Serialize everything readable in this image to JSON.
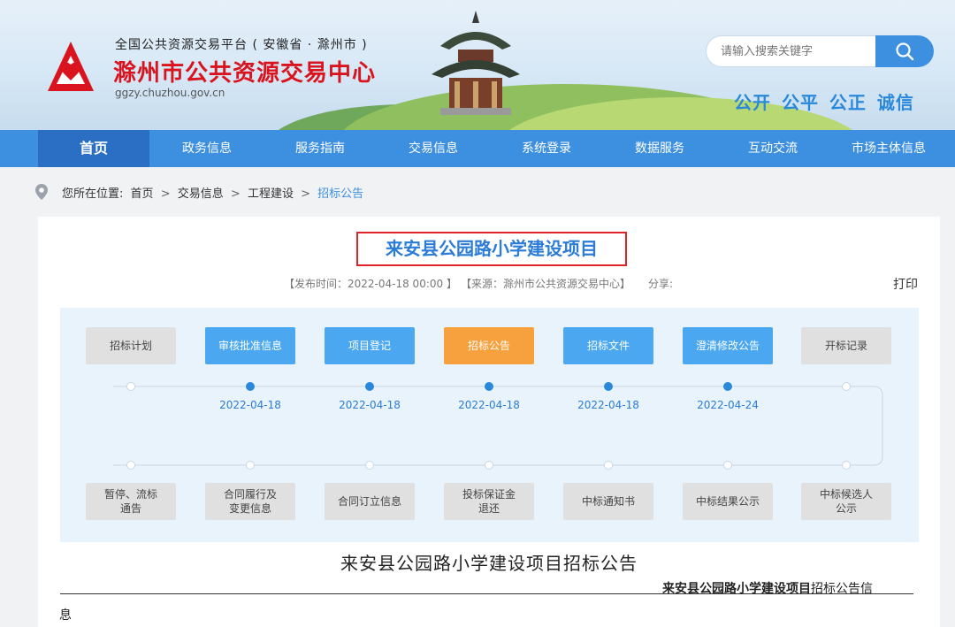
{
  "header": {
    "subtitle": "全国公共资源交易平台 ( 安徽省 · 滁州市 )",
    "title": "滁州市公共资源交易中心",
    "domain": "ggzy.chuzhou.gov.cn",
    "search_placeholder": "请输入搜索关键字",
    "slogan": "公开 公平 公正 诚信"
  },
  "nav": {
    "items": [
      "首页",
      "政务信息",
      "服务指南",
      "交易信息",
      "系统登录",
      "数据服务",
      "互动交流",
      "市场主体信息"
    ],
    "active_index": 0
  },
  "breadcrumb": {
    "label": "您所在位置:",
    "items": [
      "首页",
      "交易信息",
      "工程建设",
      "招标公告"
    ],
    "separator": ">"
  },
  "project": {
    "title": "来安县公园路小学建设项目",
    "publish": "【发布时间：2022-04-18 00:00 】",
    "source": "【来源：滁州市公共资源交易中心】",
    "share": "分享:",
    "print": "打印"
  },
  "flow": {
    "top_steps": [
      {
        "label": "招标计划",
        "state": "gray",
        "date": ""
      },
      {
        "label": "审核批准信息",
        "state": "blue",
        "date": "2022-04-18"
      },
      {
        "label": "项目登记",
        "state": "blue",
        "date": "2022-04-18"
      },
      {
        "label": "招标公告",
        "state": "orange",
        "date": "2022-04-18"
      },
      {
        "label": "招标文件",
        "state": "blue",
        "date": "2022-04-18"
      },
      {
        "label": "澄清修改公告",
        "state": "blue",
        "date": "2022-04-24"
      },
      {
        "label": "开标记录",
        "state": "gray",
        "date": ""
      }
    ],
    "bottom_steps": [
      {
        "label": "暂停、流标\n通告"
      },
      {
        "label": "合同履行及\n变更信息"
      },
      {
        "label": "合同订立信息"
      },
      {
        "label": "投标保证金\n退还"
      },
      {
        "label": "中标通知书"
      },
      {
        "label": "中标结果公示"
      },
      {
        "label": "中标候选人\n公示"
      }
    ],
    "colors": {
      "blue": "#4aa7f0",
      "orange": "#f7a03e",
      "gray": "#e0e0e0",
      "line": "#c9d6e2",
      "dot": "#2a88db"
    }
  },
  "document": {
    "title": "来安县公园路小学建设项目招标公告",
    "sub_bold": "来安县公园路小学建设项目",
    "sub_rest": "招标公告信",
    "continuation": "息"
  }
}
